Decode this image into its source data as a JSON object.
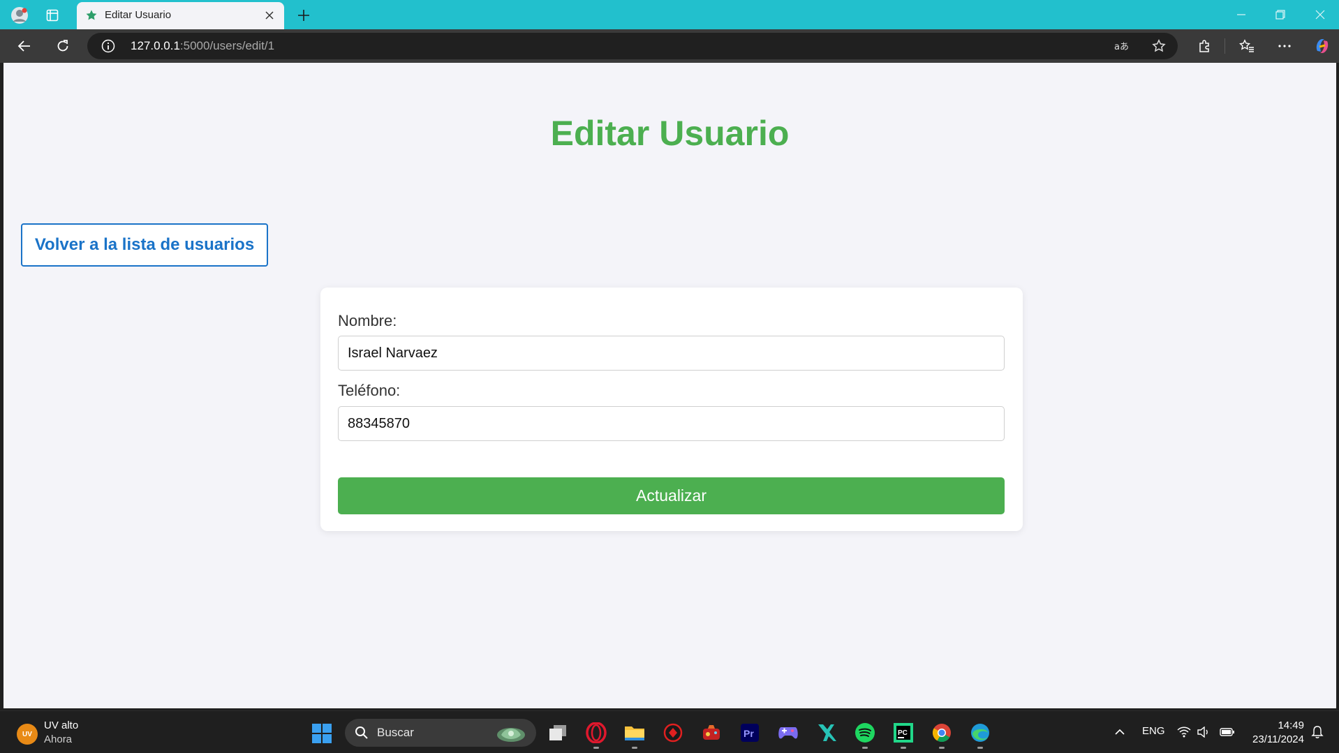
{
  "browser": {
    "tab_title": "Editar Usuario",
    "url_host": "127.0.0.1",
    "url_rest": ":5000/users/edit/1"
  },
  "page": {
    "title": "Editar Usuario",
    "back_link": "Volver a la lista de usuarios",
    "form": {
      "name_label": "Nombre:",
      "name_value": "Israel Narvaez",
      "phone_label": "Teléfono:",
      "phone_value": "88345870",
      "submit_label": "Actualizar"
    }
  },
  "taskbar": {
    "weather_badge": "UV",
    "weather_title": "UV alto",
    "weather_subtitle": "Ahora",
    "search_placeholder": "Buscar",
    "language": "ENG",
    "time": "14:49",
    "date": "23/11/2024"
  },
  "colors": {
    "accent_green": "#4caf50",
    "link_blue": "#1a73c8",
    "tabbar": "#22c0cd"
  }
}
